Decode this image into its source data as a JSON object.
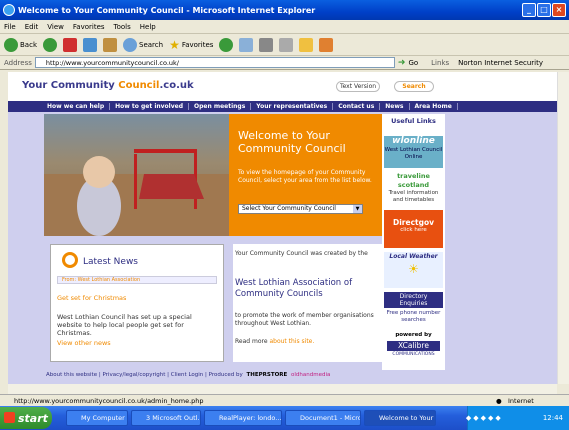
{
  "window": {
    "title": "Welcome to Your Community Council - Microsoft Internet Explorer"
  },
  "menu": [
    "File",
    "Edit",
    "View",
    "Favorites",
    "Tools",
    "Help"
  ],
  "toolbar": {
    "back": "Back",
    "search": "Search",
    "favorites": "Favorites"
  },
  "address": {
    "label": "Address",
    "url": "http://www.yourcommunitycouncil.co.uk/",
    "go": "Go",
    "links": "Links",
    "norton": "Norton Internet Security"
  },
  "site": {
    "logo_pre": "Your Community",
    "logo_accent": "Council",
    "logo_post": ".co.uk",
    "text_version": "Text Version",
    "search": "Search",
    "nav": [
      "How we can help",
      "How to get involved",
      "Open meetings",
      "Your representatives",
      "Contact us",
      "News",
      "Area Home"
    ],
    "welcome_title": "Welcome to Your Community Council",
    "welcome_text": "To view the homepage of your Community Council, select your area from the list below.",
    "select_label": "Select Your Community Council",
    "news_title": "Latest News",
    "news_from": "From: West Lothian Association",
    "news_head": "Get set for Christmas",
    "news_body": "West Lothian Council has set up a special website to help local people get set for Christmas.",
    "news_more": "View other news",
    "assoc_t1": "Your Community Council was created by the",
    "assoc_t2": "West Lothian Association of Community Councils",
    "assoc_t3": "to promote the work of member organisations throughout West Lothian.",
    "assoc_t4": "Read more",
    "assoc_link": "about this site.",
    "side_useful": "Useful Links",
    "side_wl": "wlonline",
    "side_wl_text": "West Lothian Council Online",
    "side_traveline": "traveline scotland",
    "side_travel_text": "Travel information and timetables",
    "side_directgov": "Directgov",
    "side_directgov_click": "click here",
    "side_weather": "Local Weather",
    "side_dir": "Directory Enquiries",
    "side_dir_text": "Free phone number searches",
    "side_powered": "powered by",
    "side_xcalibre": "XCalibre",
    "side_xcal_sub": "COMMUNICATIONS",
    "footer": "About this website | Privacy/legal/copyright | Client Login | Produced by",
    "footer_brand1": "THEPRSTORE",
    "footer_brand2": "oldhandmedia"
  },
  "status": {
    "url": "http://www.yourcommunitycouncil.co.uk/admin_home.php",
    "zone": "Internet"
  },
  "taskbar": {
    "start": "start",
    "tasks": [
      "My Computer",
      "3 Microsoft Outl...",
      "RealPlayer: londo...",
      "Document1 - Micro...",
      "Welcome to Your ..."
    ],
    "clock": "12:44"
  },
  "colors": {
    "accent": "#f08a00",
    "navy": "#2e2e82",
    "lavender": "#cfcfee"
  }
}
